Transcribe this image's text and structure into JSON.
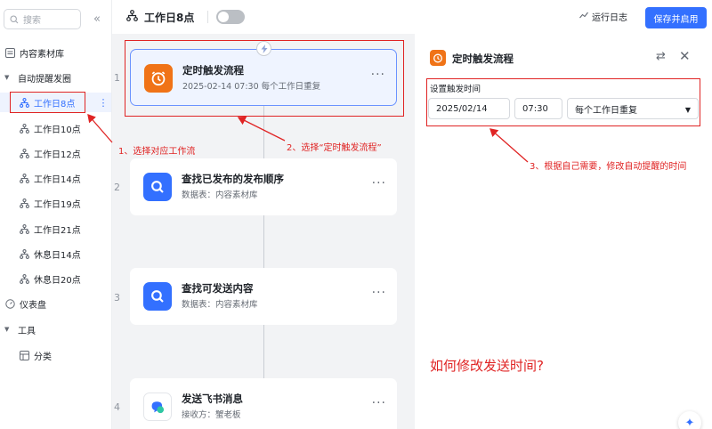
{
  "sidebar": {
    "search_placeholder": "搜索",
    "collapse_icon": "«",
    "content_library": "内容素材库",
    "group_label": "自动提醒发圈",
    "flows": [
      "工作日8点",
      "工作日10点",
      "工作日12点",
      "工作日14点",
      "工作日19点",
      "工作日21点",
      "休息日14点",
      "休息日20点"
    ],
    "dashboard": "仪表盘",
    "tools": "工具",
    "category": "分类"
  },
  "header": {
    "title": "工作日8点",
    "run_log": "运行日志",
    "save_button": "保存并启用"
  },
  "canvas": {
    "steps": [
      {
        "num": "1",
        "title": "定时触发流程",
        "subtitle": "2025-02-14 07:30 每个工作日重复"
      },
      {
        "num": "2",
        "title": "查找已发布的发布顺序",
        "subtitle": "数据表：内容素材库"
      },
      {
        "num": "3",
        "title": "查找可发送内容",
        "subtitle": "数据表：内容素材库"
      },
      {
        "num": "4",
        "title": "发送飞书消息",
        "subtitle": "接收方：蟹老板"
      }
    ],
    "more_label": "···"
  },
  "annotations": {
    "step1": "1、选择对应工作流",
    "step2": "2、选择“定时触发流程”",
    "step3": "3、根据自己需要，修改自动提醒的时间",
    "question": "如何修改发送时间?"
  },
  "panel": {
    "title": "定时触发流程",
    "setting_label": "设置触发时间",
    "date_value": "2025/02/14",
    "time_value": "07:30",
    "repeat_value": "每个工作日重复"
  },
  "colors": {
    "accent": "#3370ff",
    "trigger_orange": "#f07317",
    "annotation_red": "#e02424"
  }
}
